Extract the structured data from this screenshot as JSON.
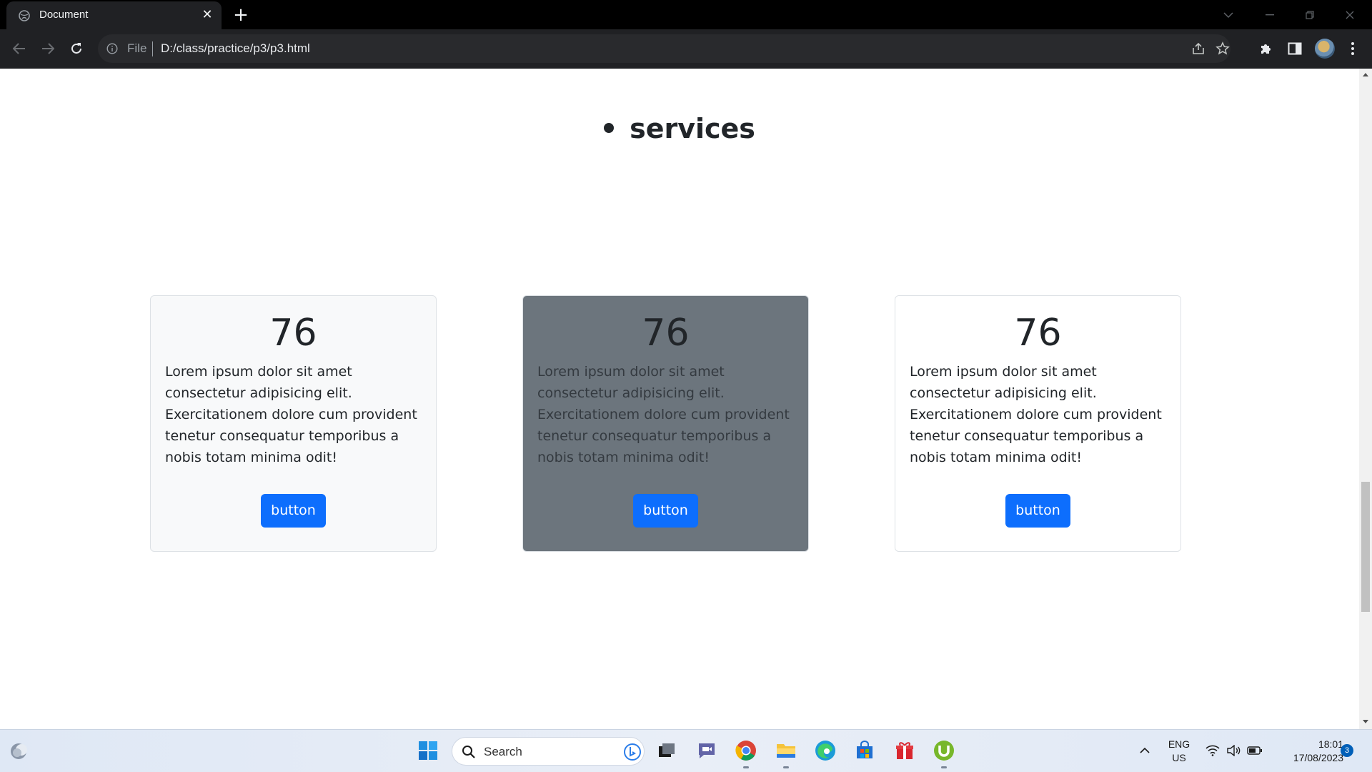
{
  "browser": {
    "tab_title": "Document",
    "tab_close": "✕",
    "new_tab": "+",
    "address_scheme": "File",
    "address_url": "D:/class/practice/p3/p3.html"
  },
  "page": {
    "heading": "services",
    "cards": [
      {
        "number": "76",
        "text": "Lorem ipsum dolor sit amet consectetur adipisicing elit. Exercitationem dolore cum provident tenetur consequatur temporibus a nobis totam minima odit!",
        "button": "button",
        "background": "#f8f9fa"
      },
      {
        "number": "76",
        "text": "Lorem ipsum dolor sit amet consectetur adipisicing elit. Exercitationem dolore cum provident tenetur consequatur temporibus a nobis totam minima odit!",
        "button": "button",
        "background": "#6c757d"
      },
      {
        "number": "76",
        "text": "Lorem ipsum dolor sit amet consectetur adipisicing elit. Exercitationem dolore cum provident tenetur consequatur temporibus a nobis totam minima odit!",
        "button": "button",
        "background": "#ffffff"
      }
    ],
    "button_color": "#0d6efd"
  },
  "taskbar": {
    "search_placeholder": "Search",
    "lang_1": "ENG",
    "lang_2": "US",
    "time": "18:01",
    "date": "17/08/2023",
    "notification_count": "3",
    "pinned_icons": [
      "start-icon",
      "bing-icon",
      "task-view-icon",
      "teams-chat-icon",
      "chrome-icon",
      "file-explorer-icon",
      "edge-icon",
      "store-icon",
      "gift-app-icon",
      "utorrent-icon"
    ]
  }
}
